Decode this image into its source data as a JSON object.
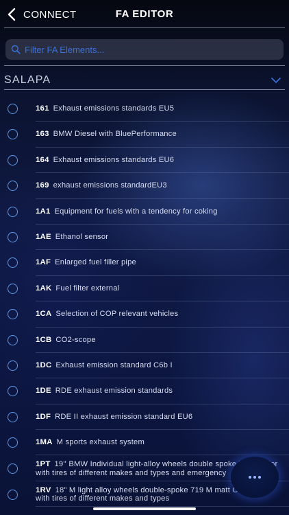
{
  "nav": {
    "back_label": "CONNECT",
    "title": "FA EDITOR"
  },
  "search": {
    "placeholder": "Filter FA Elements...",
    "value": ""
  },
  "dropdown": {
    "selected": "SALAPA"
  },
  "items": [
    {
      "code": "161",
      "text": "Exhaust emissions standards EU5"
    },
    {
      "code": "163",
      "text": "BMW Diesel with BluePerformance"
    },
    {
      "code": "164",
      "text": "Exhaust emissions standards EU6"
    },
    {
      "code": "169",
      "text": "exhaust emissions standardEU3"
    },
    {
      "code": "1A1",
      "text": "Equipment for fuels with a tendency for coking"
    },
    {
      "code": "1AE",
      "text": "Ethanol sensor"
    },
    {
      "code": "1AF",
      "text": "Enlarged fuel filler pipe"
    },
    {
      "code": "1AK",
      "text": "Fuel filter external"
    },
    {
      "code": "1CA",
      "text": "Selection of COP relevant vehicles"
    },
    {
      "code": "1CB",
      "text": "CO2-scope"
    },
    {
      "code": "1DC",
      "text": "Exhaust emission standard C6b I"
    },
    {
      "code": "1DE",
      "text": "RDE exhaust emission standards"
    },
    {
      "code": "1DF",
      "text": "RDE II exhaust emission standard EU6"
    },
    {
      "code": "1MA",
      "text": "M sports exhaust system"
    },
    {
      "code": "1PT",
      "text": "19'' BMW Individual light-alloy wheels double spoke 719 bicolor with tires of different makes and types and emergency"
    },
    {
      "code": "1RV",
      "text": "18\" M light alloy wheels double-spoke 719 M matt Orbit Gray with tires of different makes and types"
    }
  ],
  "colors": {
    "accent": "#3b6fd8",
    "radio": "#5f9ae8"
  },
  "icons": {
    "back": "chevron-left-icon",
    "search": "search-icon",
    "dropdown": "chevron-down-icon",
    "fab": "more-dots-icon"
  }
}
